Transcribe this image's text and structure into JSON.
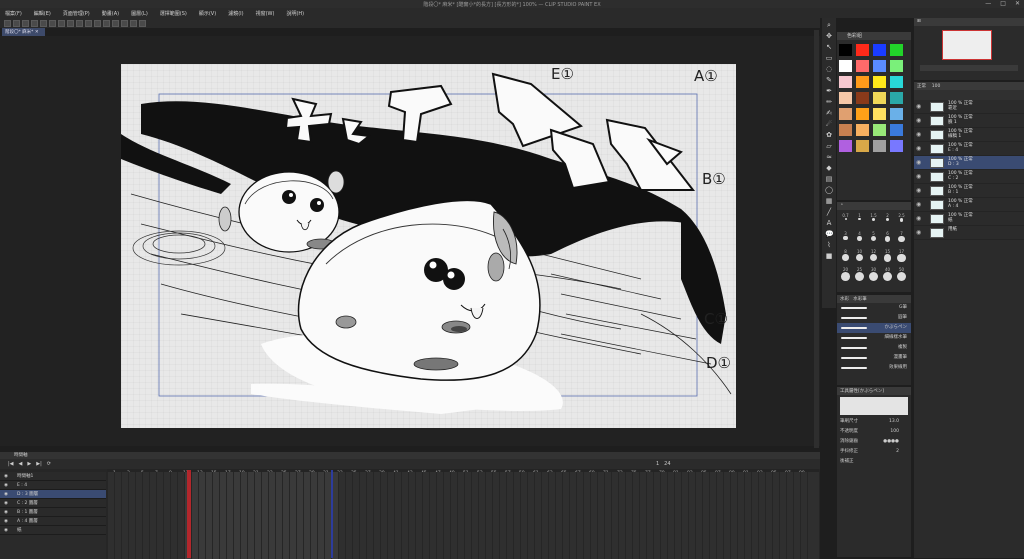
{
  "app": {
    "title": "階段〇* 麻米* [酷實小*的長方] [長方形的*] 100% — CLIP STUDIO PAINT EX",
    "window_controls": [
      "—",
      "□",
      "✕"
    ]
  },
  "menu": {
    "items": [
      "檔案(F)",
      "編輯(E)",
      "頁面管理(P)",
      "動畫(A)",
      "圖層(L)",
      "選擇範圍(S)",
      "顯示(V)",
      "濾鏡(I)",
      "視窗(W)",
      "說明(H)"
    ]
  },
  "document": {
    "tab_label": "階段〇* 麻米*"
  },
  "artwork": {
    "sfx_text": [
      "オ",
      "ッ",
      "ア",
      "ア",
      "ア",
      "ア"
    ],
    "cel_marks": [
      "E①",
      "A①",
      "B①",
      "C①",
      "D①"
    ]
  },
  "colorset": {
    "title": "色彩組",
    "swatches": [
      "#000000",
      "#ff2a1a",
      "#1a3cff",
      "#22d42a",
      "#ffffff",
      "#ff6a6a",
      "#5a8cff",
      "#7af07a",
      "#f7c8d0",
      "#ff9a1a",
      "#ffe81a",
      "#28d8d8",
      "#f6c8a8",
      "#8a3a1a",
      "#f0d858",
      "#2aa8a8",
      "#e0a070",
      "#ffa018",
      "#ffe060",
      "#6ab0e8",
      "#c88050",
      "#f8b060",
      "#98e878",
      "#3a7adc",
      "#b060e0",
      "#d8a848",
      "#a0a0a0",
      "#7878ff"
    ]
  },
  "brush_size": {
    "values": [
      "0.7",
      "1",
      "1.5",
      "2",
      "2.5",
      "3",
      "4",
      "5",
      "6",
      "7",
      "8",
      "10",
      "12",
      "15",
      "17",
      "20",
      "25",
      "30",
      "40",
      "50"
    ]
  },
  "subtool": {
    "tabs": [
      "水彩",
      "水彩筆"
    ],
    "items": [
      "G筆",
      "圓筆",
      "かぶらペン",
      "細線樣水筆",
      "複製",
      "漫畫筆",
      "效果線用"
    ]
  },
  "tool_property": {
    "title": "工具屬性[かぶらペン]",
    "rows": [
      {
        "label": "筆刷尺寸",
        "value": "13.0"
      },
      {
        "label": "不透明度",
        "value": "100"
      },
      {
        "label": "消除鋸齒",
        "value": ""
      },
      {
        "label": "手抖修正",
        "value": "2"
      },
      {
        "label": "後補正",
        "value": ""
      }
    ]
  },
  "layers": {
    "blend": "正常",
    "opacity": "100",
    "items": [
      {
        "name": "100 % 正常\n靠近",
        "selected": false
      },
      {
        "name": "100 % 正常\n臉 1",
        "selected": false
      },
      {
        "name": "100 % 正常\n線稿 1",
        "selected": false
      },
      {
        "name": "100 % 正常\nE : 4",
        "selected": false
      },
      {
        "name": "100 % 正常\nD : 3",
        "selected": true
      },
      {
        "name": "100 % 正常\nC : 2",
        "selected": false
      },
      {
        "name": "100 % 正常\nB : 1",
        "selected": false
      },
      {
        "name": "100 % 正常\nA : 4",
        "selected": false
      },
      {
        "name": "100 % 正常\n紙",
        "selected": false
      },
      {
        "name": "用紙",
        "selected": false
      }
    ]
  },
  "timeline": {
    "title": "時間軸",
    "label": "時間軸1",
    "current_frame": "1",
    "total_frames": "24",
    "ruler": [
      "1",
      "3",
      "5",
      "7",
      "9",
      "11",
      "13",
      "15",
      "17",
      "19",
      "21",
      "23",
      "25",
      "27",
      "29",
      "31",
      "33",
      "35",
      "37",
      "39",
      "41",
      "43",
      "45",
      "47",
      "49",
      "51",
      "53",
      "55",
      "57",
      "59",
      "61",
      "63",
      "65",
      "67",
      "69",
      "71",
      "73",
      "75",
      "77",
      "79",
      "81",
      "83",
      "85",
      "87",
      "89",
      "91",
      "93",
      "95",
      "97",
      "99"
    ],
    "tracks": [
      {
        "name": "時間軸1",
        "selected": false
      },
      {
        "name": "E : 4",
        "selected": false
      },
      {
        "name": "D : 3 圖層",
        "selected": true
      },
      {
        "name": "C : 2 圖層",
        "selected": false
      },
      {
        "name": "B : 1 圖層",
        "selected": false
      },
      {
        "name": "A : 4 圖層",
        "selected": false
      },
      {
        "name": "紙",
        "selected": false
      }
    ]
  }
}
